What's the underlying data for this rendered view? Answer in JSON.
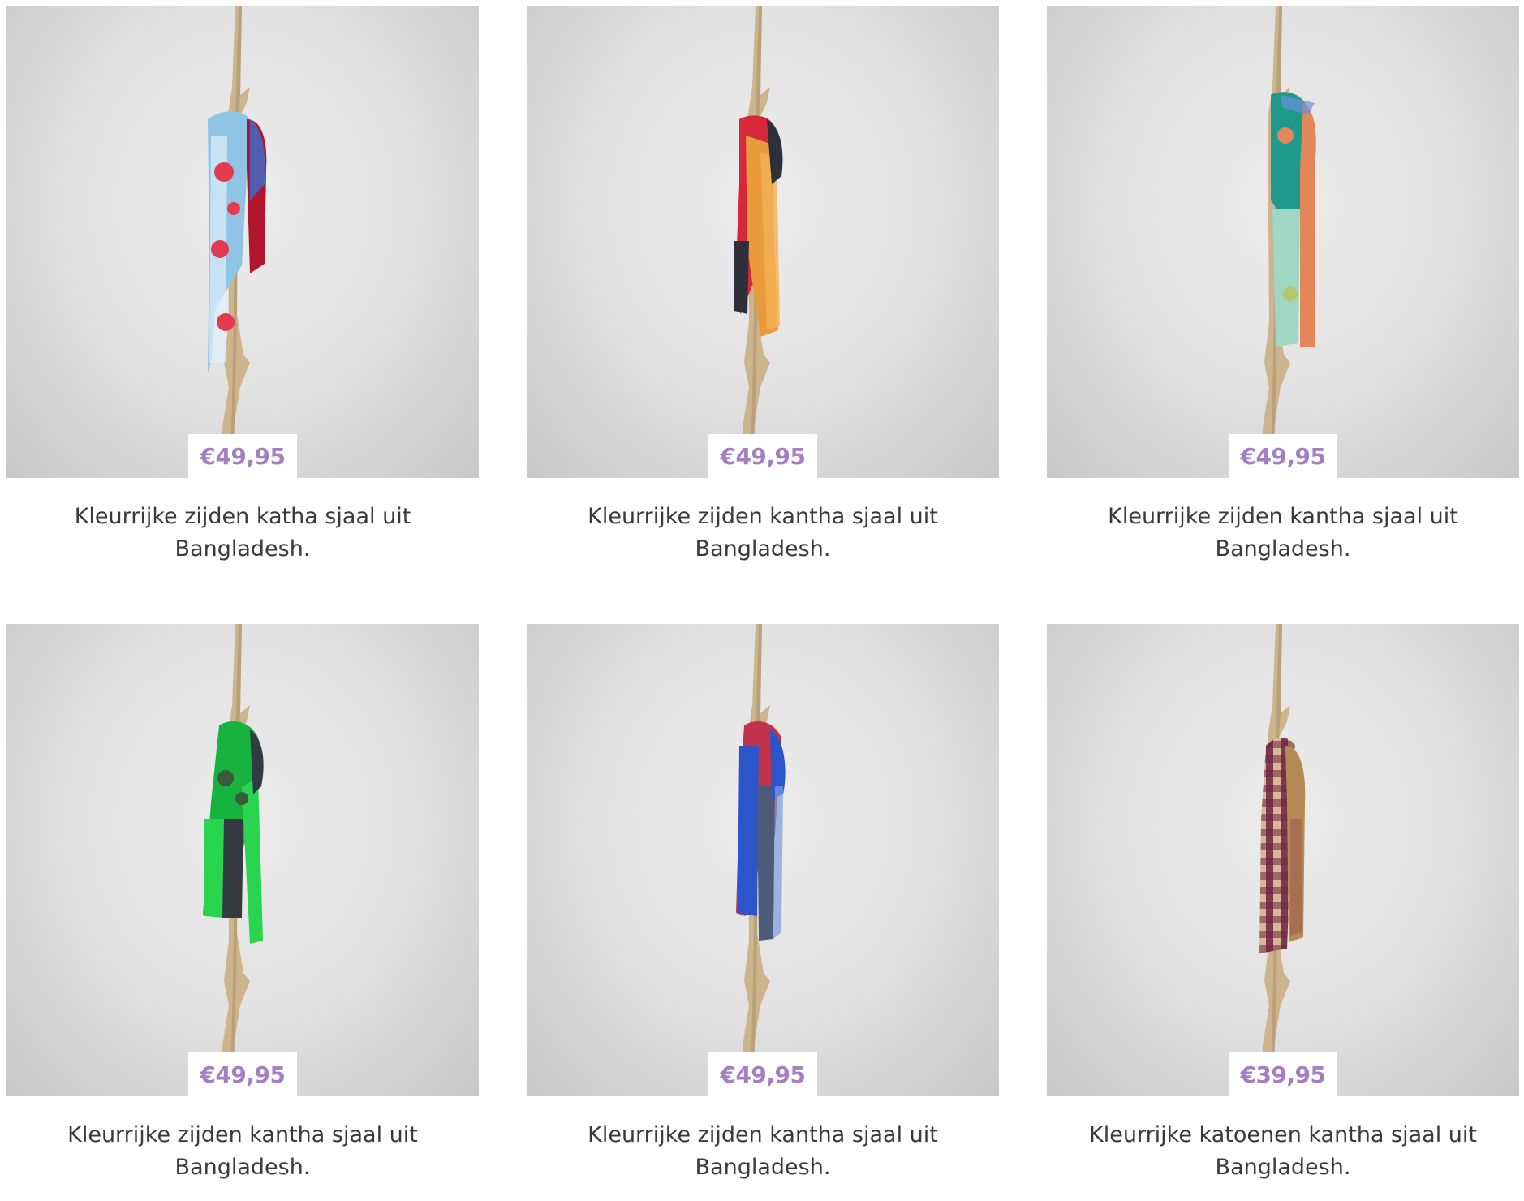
{
  "products": [
    {
      "price": "€49,95",
      "title": "Kleurrijke zijden katha sjaal uit Bangladesh.",
      "scarf_colors": [
        "#8fc4e6",
        "#e0f0fb",
        "#e23b4e",
        "#b0162e"
      ]
    },
    {
      "price": "€49,95",
      "title": "Kleurrijke zijden kantha sjaal uit Bangladesh.",
      "scarf_colors": [
        "#e99a3a",
        "#f2b155",
        "#d6283a",
        "#2d2f3a"
      ]
    },
    {
      "price": "€49,95",
      "title": "Kleurrijke zijden kantha sjaal uit Bangladesh.",
      "scarf_colors": [
        "#1f9a8a",
        "#9fd6c4",
        "#e3865a",
        "#b6c66a"
      ]
    },
    {
      "price": "€49,95",
      "title": "Kleurrijke zijden kantha sjaal uit Bangladesh.",
      "scarf_colors": [
        "#17b33f",
        "#29d44e",
        "#333a42",
        "#3b5a3a"
      ]
    },
    {
      "price": "€49,95",
      "title": "Kleurrijke zijden kantha sjaal uit Bangladesh.",
      "scarf_colors": [
        "#2c55c9",
        "#c0334a",
        "#4e5b78",
        "#7b9bdd"
      ]
    },
    {
      "price": "€39,95",
      "title": "Kleurrijke katoenen kantha sjaal uit Bangladesh.",
      "scarf_colors": [
        "#6e2340",
        "#d8b89a",
        "#b58a55",
        "#8c3a4b"
      ]
    }
  ],
  "theme": {
    "price_color": "#a67fc2",
    "text_color": "#3a3a3a",
    "branch_color": "#cdb48c"
  }
}
